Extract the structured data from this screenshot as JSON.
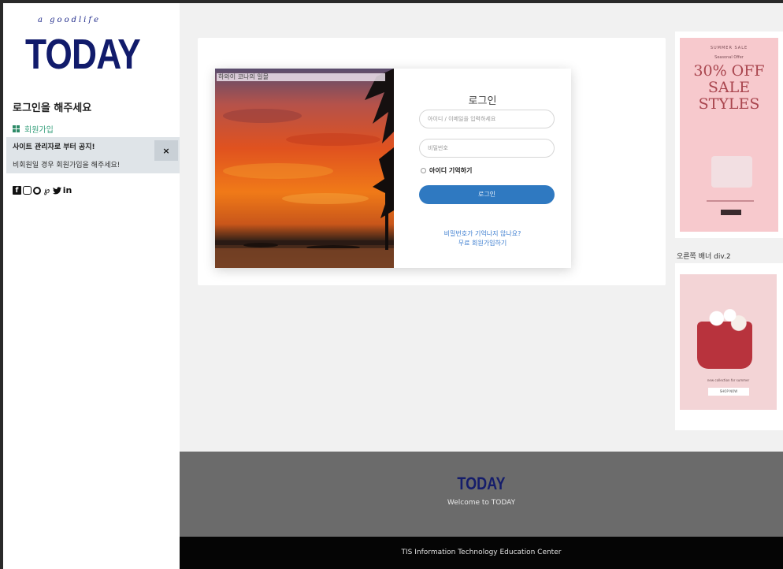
{
  "sidebar": {
    "logo_tagline": "a goodlife",
    "logo": "TODAY",
    "login_prompt": "로그인을 해주세요",
    "signup_label": "회원가입",
    "notice": {
      "title": "사이트 관리자로 부터 공지!",
      "body": "비회원일 경우 회원가입을 해주세요!",
      "close": "×"
    },
    "social_icons": [
      "facebook-icon",
      "instagram-icon",
      "github-icon",
      "pinterest-icon",
      "twitter-icon",
      "linkedin-icon"
    ]
  },
  "login": {
    "photo_caption": "하와이 코나의 일몰",
    "title": "로그인",
    "id_placeholder": "아이디 / 이메일을 입력하세요",
    "pw_placeholder": "비밀번호",
    "remember_label": "아이디 기억하기",
    "submit_label": "로그인",
    "forgot_label": "비밀번호가 기억나지 않나요?",
    "signup_label": "무료 회원가입하기"
  },
  "banners": {
    "banner1": {
      "small_top": "SUMMER SALE",
      "small_sub": "Seasonal Offer",
      "offer_lines": [
        "30% OFF",
        "SALE",
        "STYLES"
      ]
    },
    "right_label": "오른쪽 배너 div.2",
    "banner2": {
      "text": "new collection for summer",
      "button": "SHOP NOW"
    }
  },
  "footer": {
    "logo": "TODAY",
    "welcome": "Welcome to TODAY",
    "copyright": "TIS Information Technology Education Center"
  },
  "colors": {
    "logo_navy": "#111b6b",
    "login_button": "#2f79c1",
    "signup_green": "#3aa17e",
    "footer_gray": "#6b6b6b",
    "footer_black": "#050505"
  }
}
